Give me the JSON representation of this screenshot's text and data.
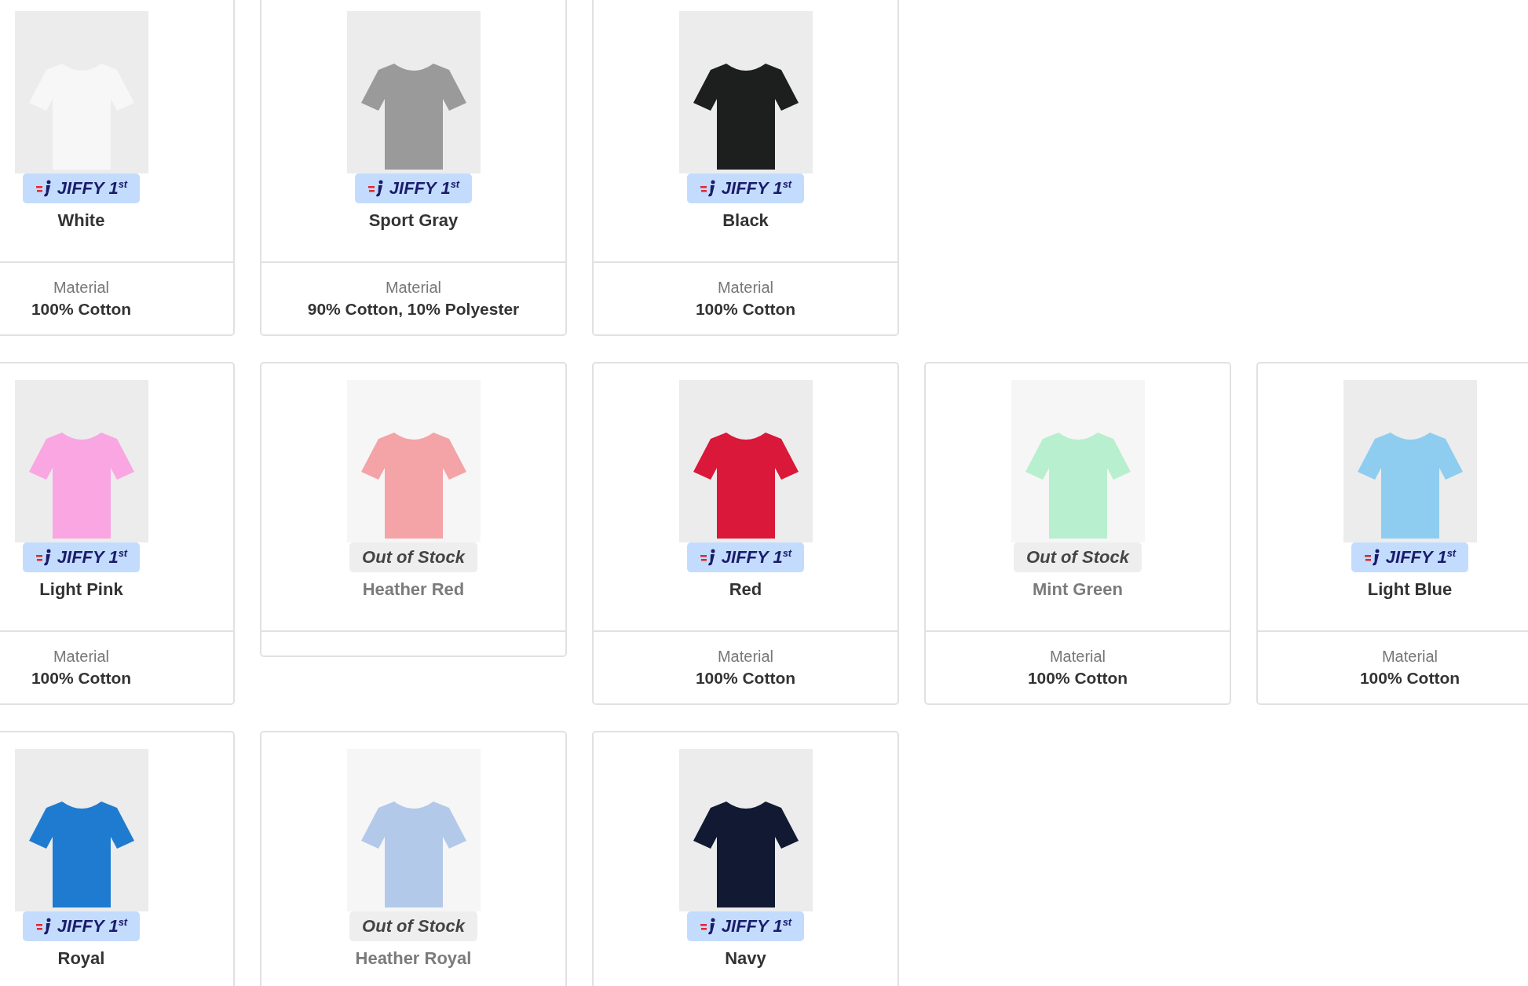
{
  "product_rows": [
    {
      "products": [
        {
          "name": "White",
          "color": "#f7f7f7",
          "in_stock": true,
          "badge": "JIFFY 1$^{st}$",
          "material_label": "Material",
          "material": "100% Cotton"
        },
        {
          "name": "Sport Gray",
          "color": "#9a9a9a",
          "in_stock": true,
          "badge": "JIFFY 1$^{st}$",
          "material_label": "Material",
          "material": "90% Cotton, 10% Polyester"
        },
        {
          "name": "Black",
          "color": "#1d1f1e",
          "in_stock": true,
          "badge": "JIFFY 1$^{st}$",
          "material_label": "Material",
          "material": "100% Cotton"
        }
      ]
    },
    {
      "products": [
        {
          "name": "Light Pink",
          "color": "#f9a6e2",
          "in_stock": true,
          "badge": "JIFFY 1$^{st}$",
          "material_label": "Material",
          "material": "100% Cotton"
        },
        {
          "name": "Heather Red",
          "color": "#f4a3a6",
          "in_stock": false,
          "badge": "Out of Stock"
        },
        {
          "name": "Red",
          "color": "#d9183a",
          "in_stock": true,
          "badge": "JIFFY 1$^{st}$",
          "material_label": "Material",
          "material": "100% Cotton"
        },
        {
          "name": "Mint Green",
          "color": "#b8efcf",
          "in_stock": false,
          "badge": "Out of Stock",
          "material_label": "Material",
          "material": "100% Cotton"
        },
        {
          "name": "Light Blue",
          "color": "#8ecdf0",
          "in_stock": true,
          "badge": "JIFFY 1$^{st}$",
          "material_label": "Material",
          "material": "100% Cotton"
        }
      ]
    },
    {
      "products": [
        {
          "name": "Royal",
          "color": "#1f7bd0",
          "in_stock": true,
          "badge": "JIFFY 1$^{st}$"
        },
        {
          "name": "Heather Royal",
          "color": "#b3c9ea",
          "in_stock": false,
          "badge": "Out of Stock"
        },
        {
          "name": "Navy",
          "color": "#121a33",
          "in_stock": true,
          "badge": "JIFFY 1$^{st}$"
        }
      ]
    }
  ]
}
